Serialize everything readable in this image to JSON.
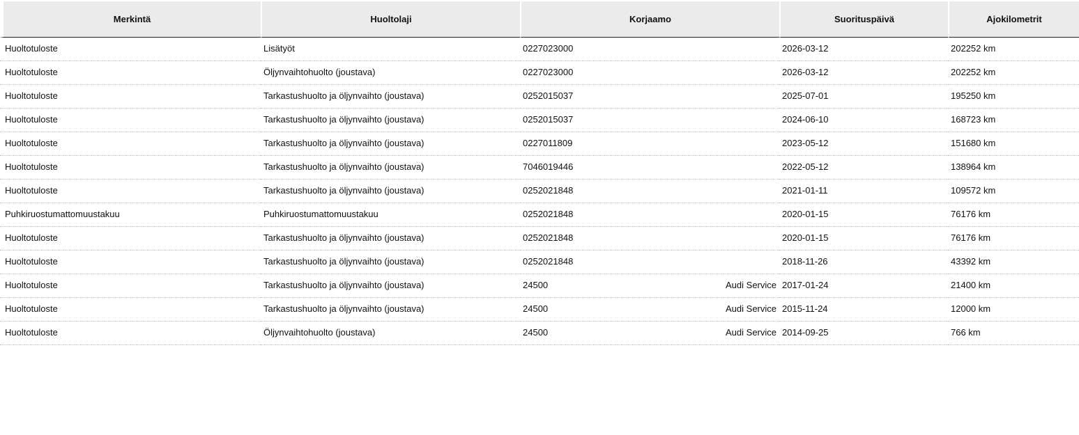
{
  "table": {
    "headers": [
      "Merkintä",
      "Huoltolaji",
      "Korjaamo",
      "Suorituspäivä",
      "Ajokilometrit"
    ],
    "rows": [
      {
        "merkinta": "Huoltotuloste",
        "huoltolaji": "Lisätyöt",
        "korjaamo_id": "0227023000",
        "korjaamo_name": "",
        "paiva": "2026-03-12",
        "km": "202252 km"
      },
      {
        "merkinta": "Huoltotuloste",
        "huoltolaji": "Öljynvaihtohuolto (joustava)",
        "korjaamo_id": "0227023000",
        "korjaamo_name": "",
        "paiva": "2026-03-12",
        "km": "202252 km"
      },
      {
        "merkinta": "Huoltotuloste",
        "huoltolaji": "Tarkastushuolto ja öljynvaihto (joustava)",
        "korjaamo_id": "0252015037",
        "korjaamo_name": "",
        "paiva": "2025-07-01",
        "km": "195250 km"
      },
      {
        "merkinta": "Huoltotuloste",
        "huoltolaji": "Tarkastushuolto ja öljynvaihto (joustava)",
        "korjaamo_id": "0252015037",
        "korjaamo_name": "",
        "paiva": "2024-06-10",
        "km": "168723 km"
      },
      {
        "merkinta": "Huoltotuloste",
        "huoltolaji": "Tarkastushuolto ja öljynvaihto (joustava)",
        "korjaamo_id": "0227011809",
        "korjaamo_name": "",
        "paiva": "2023-05-12",
        "km": "151680 km"
      },
      {
        "merkinta": "Huoltotuloste",
        "huoltolaji": "Tarkastushuolto ja öljynvaihto (joustava)",
        "korjaamo_id": "7046019446",
        "korjaamo_name": "",
        "paiva": "2022-05-12",
        "km": "138964 km"
      },
      {
        "merkinta": "Huoltotuloste",
        "huoltolaji": "Tarkastushuolto ja öljynvaihto (joustava)",
        "korjaamo_id": "0252021848",
        "korjaamo_name": "",
        "paiva": "2021-01-11",
        "km": "109572 km"
      },
      {
        "merkinta": "Puhkiruostumattomuustakuu",
        "huoltolaji": "Puhkiruostumattomuustakuu",
        "korjaamo_id": "0252021848",
        "korjaamo_name": "",
        "paiva": "2020-01-15",
        "km": "76176 km"
      },
      {
        "merkinta": "Huoltotuloste",
        "huoltolaji": "Tarkastushuolto ja öljynvaihto (joustava)",
        "korjaamo_id": "0252021848",
        "korjaamo_name": "",
        "paiva": "2020-01-15",
        "km": "76176 km"
      },
      {
        "merkinta": "Huoltotuloste",
        "huoltolaji": "Tarkastushuolto ja öljynvaihto (joustava)",
        "korjaamo_id": "0252021848",
        "korjaamo_name": "",
        "paiva": "2018-11-26",
        "km": "43392 km"
      },
      {
        "merkinta": "Huoltotuloste",
        "huoltolaji": "Tarkastushuolto ja öljynvaihto (joustava)",
        "korjaamo_id": "24500",
        "korjaamo_name": "Audi Service",
        "paiva": "2017-01-24",
        "km": "21400 km"
      },
      {
        "merkinta": "Huoltotuloste",
        "huoltolaji": "Tarkastushuolto ja öljynvaihto (joustava)",
        "korjaamo_id": "24500",
        "korjaamo_name": "Audi Service",
        "paiva": "2015-11-24",
        "km": "12000 km"
      },
      {
        "merkinta": "Huoltotuloste",
        "huoltolaji": "Öljynvaihtohuolto (joustava)",
        "korjaamo_id": "24500",
        "korjaamo_name": "Audi Service",
        "paiva": "2014-09-25",
        "km": "766 km"
      }
    ]
  }
}
